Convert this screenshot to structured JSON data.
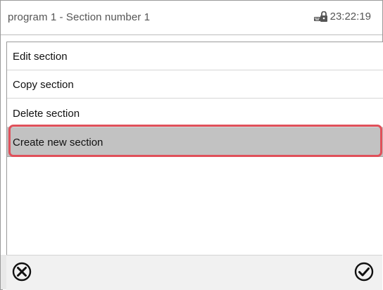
{
  "header": {
    "title": "program 1 - Section number 1",
    "time": "23:22:19",
    "lock_icon": "lock-keyboard-icon"
  },
  "menu": {
    "items": [
      {
        "label": "Edit section",
        "selected": false
      },
      {
        "label": "Copy section",
        "selected": false
      },
      {
        "label": "Delete section",
        "selected": false
      },
      {
        "label": "Create new section",
        "selected": true
      }
    ]
  },
  "footer": {
    "cancel_icon": "cancel-x-icon",
    "confirm_icon": "confirm-check-icon"
  },
  "colors": {
    "selected_row": "#c2c2c2",
    "highlight_border": "#e0505a",
    "text": "#111111",
    "header_text": "#555555"
  }
}
